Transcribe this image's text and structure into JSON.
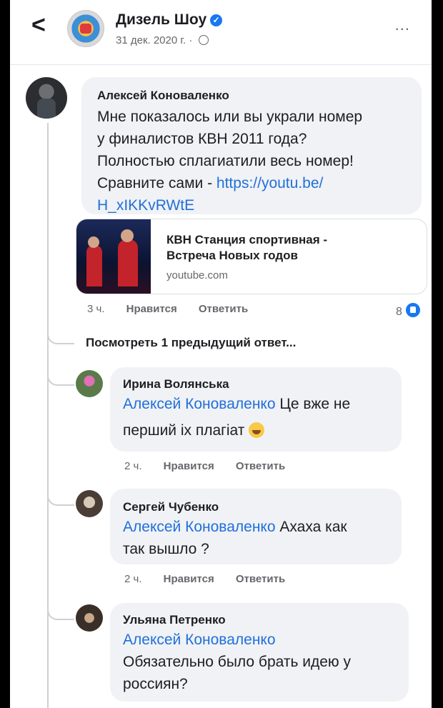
{
  "header": {
    "back_glyph": "<",
    "page_name": "Дизель Шоу",
    "verified_icon": "verified-badge-icon",
    "date": "31 дек. 2020 г.",
    "separator": "·",
    "more_glyph": "..."
  },
  "main_comment": {
    "author": "Алексей Коноваленко",
    "text_lines": [
      "Мне показалось или вы украли номер",
      "у финалистов КВН 2011 года?",
      "Полностью сплагиатили весь номер!",
      "Сравните сами - "
    ],
    "link_part1": "https://youtu.be/",
    "link_part2": "H_xIKKvRWtE",
    "preview": {
      "title_line1": "КВН Станция спортивная -",
      "title_line2": "Встреча Новых годов",
      "domain": "youtube.com"
    },
    "time": "3 ч.",
    "like_label": "Нравится",
    "reply_label": "Ответить",
    "reaction_count": "8"
  },
  "view_previous": "Посмотреть 1 предыдущий ответ...",
  "replies": [
    {
      "author": "Ирина Волянська",
      "mention": "Алексей Коноваленко",
      "text_a": " Це вже не",
      "text_b": "перший іх плагіат",
      "emoji": "laughing-emoji-icon",
      "time": "2 ч.",
      "like_label": "Нравится",
      "reply_label": "Ответить"
    },
    {
      "author": "Сергей Чубенко",
      "mention": "Алексей Коноваленко",
      "text_a": "  Ахаха как",
      "text_b": "так вышло  ?",
      "time": "2 ч.",
      "like_label": "Нравится",
      "reply_label": "Ответить"
    },
    {
      "author": "Ульяна Петренко",
      "mention": "Алексей Коноваленко",
      "text_b": "Обязательно было брать идею у",
      "text_c": "россиян?"
    }
  ],
  "colors": {
    "link": "#216fdb",
    "bubble": "#f0f2f5",
    "secondary_text": "#65676b",
    "like_blue": "#1877f2"
  }
}
